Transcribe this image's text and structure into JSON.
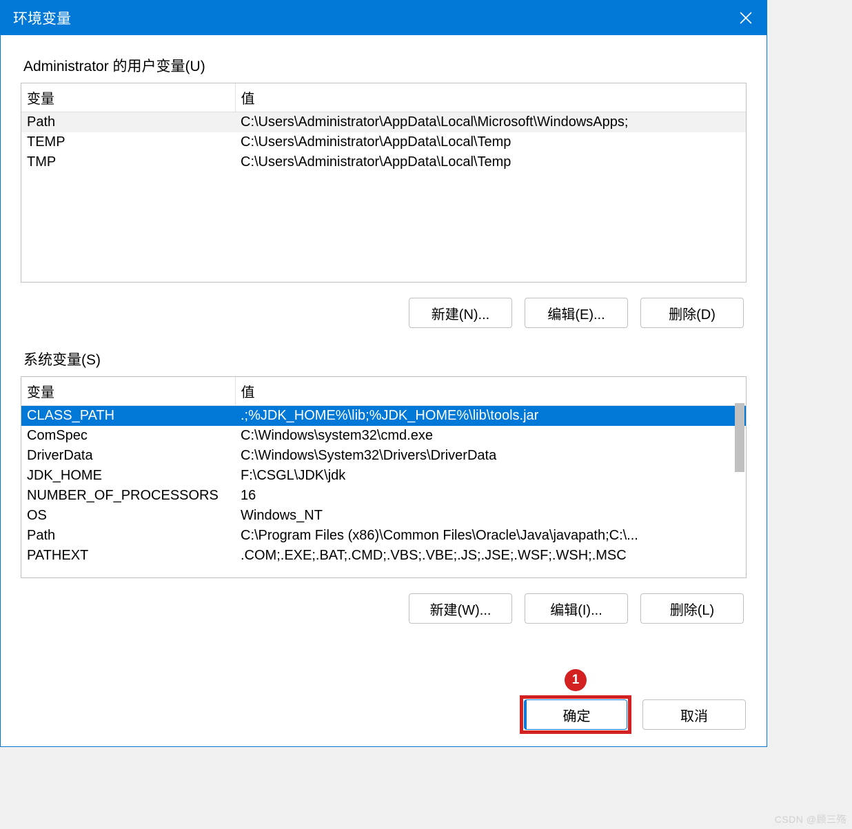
{
  "window": {
    "title": "环境变量"
  },
  "user_section": {
    "label": "Administrator 的用户变量(U)",
    "headers": {
      "variable": "变量",
      "value": "值"
    },
    "rows": [
      {
        "variable": "Path",
        "value": "C:\\Users\\Administrator\\AppData\\Local\\Microsoft\\WindowsApps;"
      },
      {
        "variable": "TEMP",
        "value": "C:\\Users\\Administrator\\AppData\\Local\\Temp"
      },
      {
        "variable": "TMP",
        "value": "C:\\Users\\Administrator\\AppData\\Local\\Temp"
      }
    ],
    "buttons": {
      "new": "新建(N)...",
      "edit": "编辑(E)...",
      "delete": "删除(D)"
    }
  },
  "system_section": {
    "label": "系统变量(S)",
    "headers": {
      "variable": "变量",
      "value": "值"
    },
    "rows": [
      {
        "variable": "CLASS_PATH",
        "value": ".;%JDK_HOME%\\lib;%JDK_HOME%\\lib\\tools.jar"
      },
      {
        "variable": "ComSpec",
        "value": "C:\\Windows\\system32\\cmd.exe"
      },
      {
        "variable": "DriverData",
        "value": "C:\\Windows\\System32\\Drivers\\DriverData"
      },
      {
        "variable": "JDK_HOME",
        "value": "F:\\CSGL\\JDK\\jdk"
      },
      {
        "variable": "NUMBER_OF_PROCESSORS",
        "value": "16"
      },
      {
        "variable": "OS",
        "value": "Windows_NT"
      },
      {
        "variable": "Path",
        "value": "C:\\Program Files (x86)\\Common Files\\Oracle\\Java\\javapath;C:\\..."
      },
      {
        "variable": "PATHEXT",
        "value": ".COM;.EXE;.BAT;.CMD;.VBS;.VBE;.JS;.JSE;.WSF;.WSH;.MSC"
      }
    ],
    "selected_index": 0,
    "buttons": {
      "new": "新建(W)...",
      "edit": "编辑(I)...",
      "delete": "删除(L)"
    }
  },
  "bottom_buttons": {
    "ok": "确定",
    "cancel": "取消"
  },
  "annotation": {
    "badge": "1"
  },
  "watermark": "CSDN @顾三殇"
}
